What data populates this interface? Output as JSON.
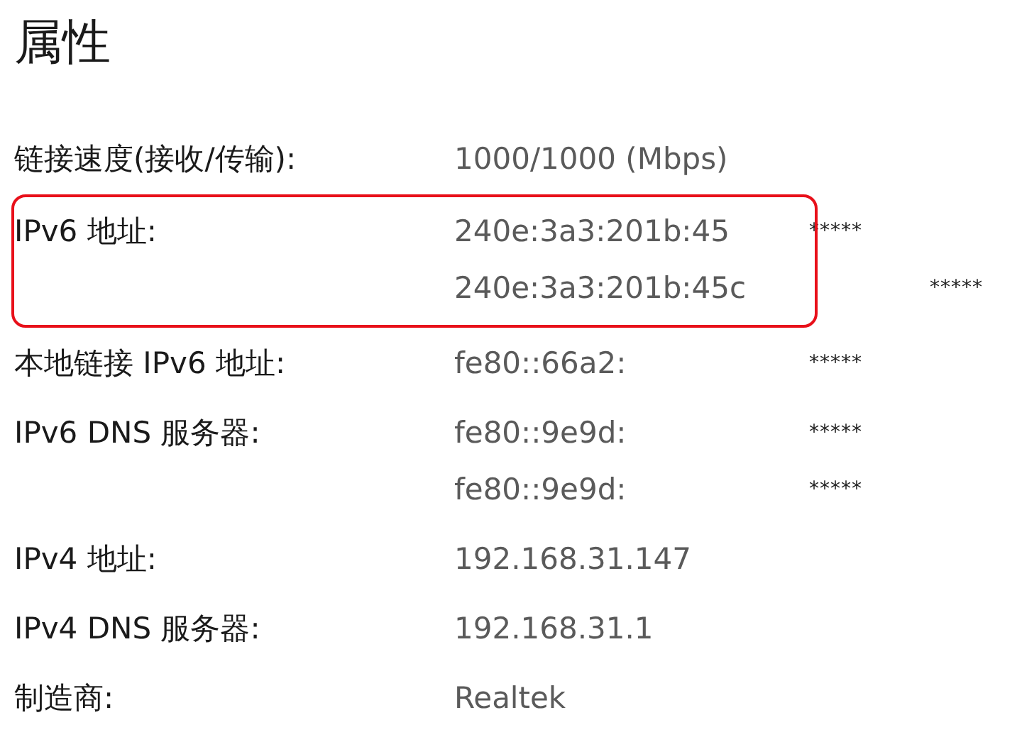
{
  "title": "属性",
  "properties": [
    {
      "label": "链接速度(接收/传输):",
      "highlighted": false,
      "values": [
        {
          "text": "1000/1000 (Mbps)"
        }
      ]
    },
    {
      "label": "IPv6 地址:",
      "highlighted": true,
      "values": [
        {
          "text": "240e:3a3:201b:45",
          "mask": "*****"
        },
        {
          "text": "240e:3a3:201b:45c",
          "mask": "*****"
        }
      ]
    },
    {
      "label": "本地链接 IPv6 地址:",
      "highlighted": false,
      "values": [
        {
          "text": "fe80::66a2:",
          "mask": "*****"
        }
      ]
    },
    {
      "label": "IPv6 DNS 服务器:",
      "highlighted": false,
      "values": [
        {
          "text": "fe80::9e9d:",
          "mask": "*****"
        },
        {
          "text": "fe80::9e9d:",
          "mask": "*****"
        }
      ]
    },
    {
      "label": "IPv4 地址:",
      "highlighted": false,
      "values": [
        {
          "text": "192.168.31.147"
        }
      ]
    },
    {
      "label": "IPv4 DNS 服务器:",
      "highlighted": false,
      "values": [
        {
          "text": "192.168.31.1"
        }
      ]
    },
    {
      "label": "制造商:",
      "highlighted": false,
      "values": [
        {
          "text": "Realtek"
        }
      ]
    }
  ]
}
